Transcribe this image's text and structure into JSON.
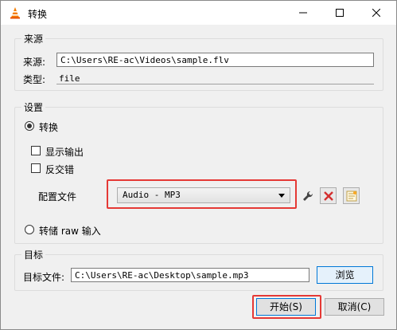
{
  "window": {
    "title": "转换",
    "accent": "#e53935"
  },
  "source": {
    "legend": "来源",
    "source_label": "来源:",
    "source_value": "C:\\Users\\RE-ac\\Videos\\sample.flv",
    "type_label": "类型:",
    "type_value": "file"
  },
  "settings": {
    "legend": "设置",
    "convert_label": "转换",
    "convert_selected": true,
    "show_output_label": "显示输出",
    "deinterlace_label": "反交错",
    "profile_label": "配置文件",
    "profile_value": "Audio - MP3",
    "dump_raw_label": "转储 raw 输入"
  },
  "destination": {
    "legend": "目标",
    "file_label": "目标文件:",
    "file_value": "C:\\Users\\RE-ac\\Desktop\\sample.mp3",
    "browse_label": "浏览"
  },
  "footer": {
    "start_label": "开始(S)",
    "cancel_label": "取消(C)"
  },
  "icons": {
    "app": "vlc-cone-icon",
    "minimize": "minimize-icon",
    "maximize": "maximize-icon",
    "close": "close-icon",
    "edit_profile": "wrench-icon",
    "delete_profile": "red-x-icon",
    "new_profile": "new-profile-icon"
  }
}
